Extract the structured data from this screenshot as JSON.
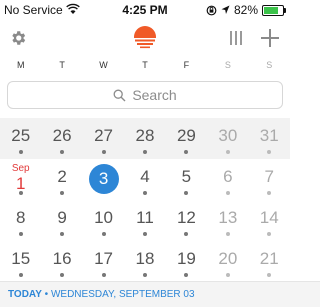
{
  "status_bar": {
    "carrier": "No Service",
    "time": "4:25 PM",
    "battery": "82%",
    "battery_level": 0.82
  },
  "colors": {
    "accent": "#2d86d6",
    "brand": "#f05a28",
    "weekend": "#aaaaaa",
    "month_marker": "#e23b3b"
  },
  "toolbar": {
    "settings_icon": "gear-icon",
    "logo_icon": "sunrise-logo",
    "view_icon": "columns-icon",
    "add_icon": "plus-icon"
  },
  "weekdays": [
    "M",
    "T",
    "W",
    "T",
    "F",
    "S",
    "S"
  ],
  "search": {
    "placeholder": "Search"
  },
  "calendar": {
    "weeks": [
      [
        "25",
        "26",
        "27",
        "28",
        "29",
        "30",
        "31"
      ],
      [
        "1",
        "2",
        "3",
        "4",
        "5",
        "6",
        "7"
      ],
      [
        "8",
        "9",
        "10",
        "11",
        "12",
        "13",
        "14"
      ],
      [
        "15",
        "16",
        "17",
        "18",
        "19",
        "20",
        "21"
      ]
    ],
    "month_label": "Sep",
    "selected_day": "3"
  },
  "today_bar": {
    "today": "TODAY",
    "separator": " • ",
    "date": "WEDNESDAY, SEPTEMBER 03"
  }
}
